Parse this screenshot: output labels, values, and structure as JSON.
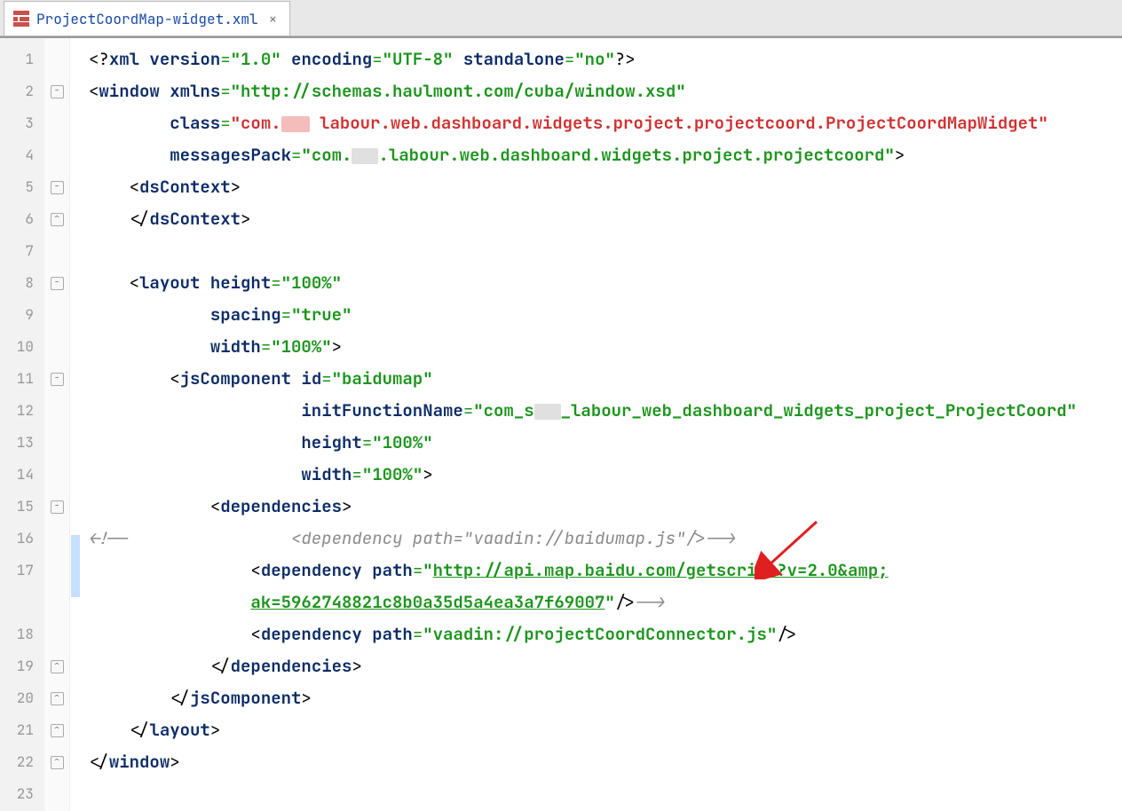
{
  "tab": {
    "title": "ProjectCoordMap-widget.xml",
    "close": "×"
  },
  "gutter_lines": [
    "1",
    "2",
    "3",
    "4",
    "5",
    "6",
    "7",
    "8",
    "9",
    "10",
    "11",
    "12",
    "13",
    "14",
    "15",
    "16",
    "17",
    "18",
    "19",
    "20",
    "21",
    "22",
    "23"
  ],
  "code": {
    "l1": {
      "pre": "<?",
      "tag": "xml",
      "a1": " version",
      "v1": "\"1.0\"",
      "a2": " encoding",
      "v2": "\"UTF-8\"",
      "a3": " standalone",
      "v3": "\"no\"",
      "suf": "?>"
    },
    "l2": {
      "open": "<",
      "tag": "window",
      "a1": " xmlns",
      "v1": "\"http://schemas.haulmont.com/cuba/window.xsd\""
    },
    "l3": {
      "a1": "class",
      "eq": "=",
      "vpre": "\"com.",
      "vrest": " labour.web.dashboard.widgets.project.projectcoord.ProjectCoordMapWidget\""
    },
    "l4": {
      "a1": "messagesPack",
      "v1": "\"com.",
      "vmid": ".labour.web.dashboard.widgets.project.",
      "vend": "projectcoord\"",
      "close": ">"
    },
    "l5": {
      "open": "<",
      "tag": "dsContext",
      "close": ">"
    },
    "l6": {
      "open": "</",
      "tag": "dsContext",
      "close": ">"
    },
    "l8": {
      "open": "<",
      "tag": "layout",
      "a1": " height",
      "v1": "\"100%\""
    },
    "l9": {
      "a1": "spacing",
      "v1": "\"true\""
    },
    "l10": {
      "a1": "width",
      "v1": "\"100%\"",
      "close": ">"
    },
    "l11": {
      "open": "<",
      "tag": "jsComponent",
      "a1": " id",
      "v1": "\"baidumap\""
    },
    "l12": {
      "a1": "initFunctionName",
      "v1": "\"com_s",
      "v2": "_labour_web_dashboard_widgets_project_ProjectCoord\""
    },
    "l13": {
      "a1": "height",
      "v1": "\"100%\""
    },
    "l14": {
      "a1": "width",
      "v1": "\"100%\"",
      "close": ">"
    },
    "l15": {
      "open": "<",
      "tag": "dependencies",
      "close": ">"
    },
    "l16": {
      "cmt_open": "<!--",
      "cmt": "                <dependency path=\"vaadin://baidumap.js\"/>-->"
    },
    "l17": {
      "open": "<",
      "tag": "dependency",
      "a1": " path",
      "eq": "=",
      "q": "\"",
      "url": "http://api.map.baidu.com/getscript?v=2.0&amp;"
    },
    "l17b": {
      "url": "ak=5962748821c8b0a35d5a4ea3a7f69007",
      "q": "\"",
      "close": "/>",
      "trail": "-->"
    },
    "l18": {
      "open": "<",
      "tag": "dependency",
      "a1": " path",
      "v1": "\"vaadin://projectCoordConnector.js\"",
      "close": "/>"
    },
    "l19": {
      "open": "</",
      "tag": "dependencies",
      "close": ">"
    },
    "l20": {
      "open": "</",
      "tag": "jsComponent",
      "close": ">"
    },
    "l21": {
      "open": "</",
      "tag": "layout",
      "close": ">"
    },
    "l22": {
      "open": "</",
      "tag": "window",
      "close": ">"
    }
  }
}
